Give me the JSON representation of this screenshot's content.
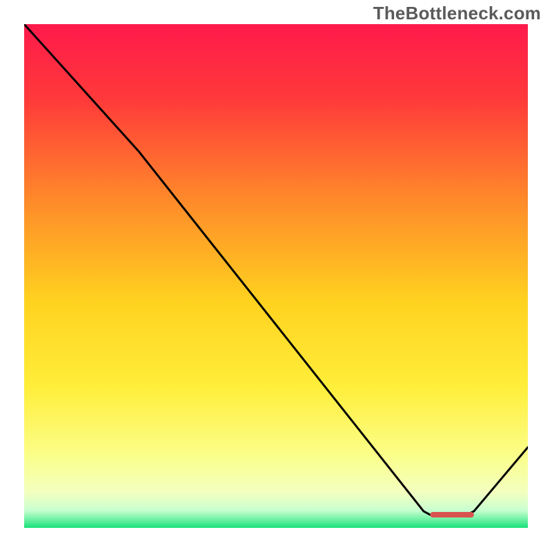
{
  "watermark": "TheBottleneck.com",
  "chart_data": {
    "type": "line",
    "title": "",
    "xlabel": "",
    "ylabel": "",
    "xlim": [
      0,
      100
    ],
    "ylim": [
      0,
      100
    ],
    "gradient_stops": [
      {
        "offset": 0.0,
        "color": "#ff1a4b"
      },
      {
        "offset": 0.15,
        "color": "#ff3a3a"
      },
      {
        "offset": 0.35,
        "color": "#ff8a2a"
      },
      {
        "offset": 0.55,
        "color": "#ffd21f"
      },
      {
        "offset": 0.72,
        "color": "#ffee3a"
      },
      {
        "offset": 0.86,
        "color": "#fbff8c"
      },
      {
        "offset": 0.93,
        "color": "#f3ffbf"
      },
      {
        "offset": 0.965,
        "color": "#c9ffd0"
      },
      {
        "offset": 0.985,
        "color": "#66f0a0"
      },
      {
        "offset": 1.0,
        "color": "#18e07a"
      }
    ],
    "curve": {
      "x": [
        0,
        22.7,
        79.3,
        80.6,
        87.9,
        89.3,
        100
      ],
      "y": [
        100,
        74.8,
        3.3,
        2.6,
        2.6,
        3.3,
        16.0
      ]
    },
    "optimal_marker": {
      "x_start": 80.6,
      "x_end": 89.3,
      "y": 2.6,
      "color": "#d9534f"
    }
  }
}
